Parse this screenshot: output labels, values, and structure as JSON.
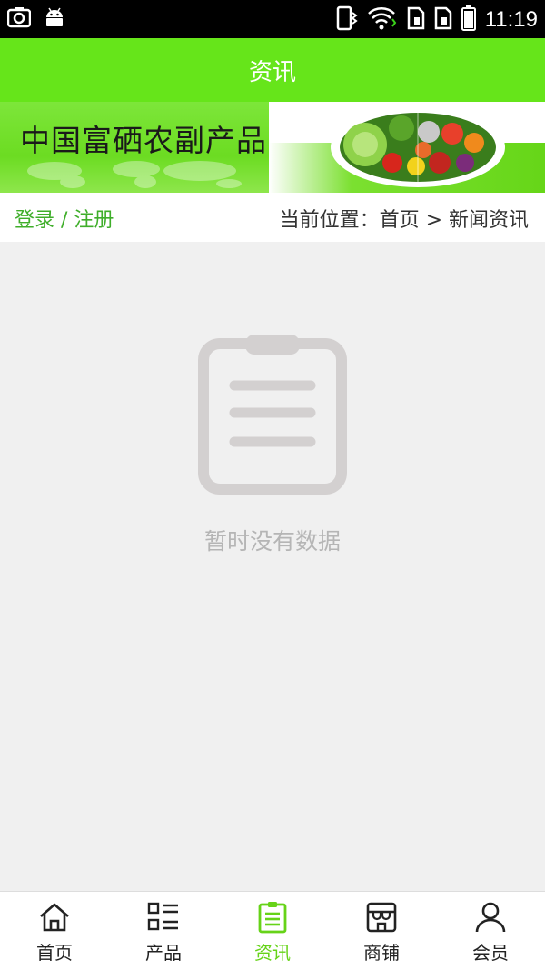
{
  "status_bar": {
    "time": "11:19"
  },
  "header": {
    "title": "资讯"
  },
  "banner": {
    "brand_text": "中国富硒农副产品"
  },
  "breadcrumb": {
    "login_register": "登录 / 注册",
    "location": "当前位置：首页 > 新闻资讯"
  },
  "empty_state": {
    "message": "暂时没有数据"
  },
  "bottom_nav": {
    "items": [
      {
        "label": "首页",
        "icon": "home-icon",
        "active": false
      },
      {
        "label": "产品",
        "icon": "product-list-icon",
        "active": false
      },
      {
        "label": "资讯",
        "icon": "news-icon",
        "active": true
      },
      {
        "label": "商铺",
        "icon": "shop-icon",
        "active": false
      },
      {
        "label": "会员",
        "icon": "member-icon",
        "active": false
      }
    ]
  },
  "colors": {
    "primary_green": "#66e51a",
    "active_tab": "#66d318",
    "link_green": "#3fae2a",
    "empty_text": "#b5b5b5"
  }
}
